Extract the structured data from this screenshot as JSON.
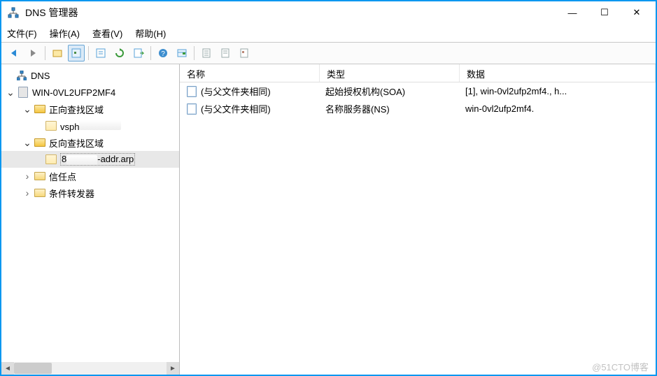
{
  "window": {
    "title": "DNS 管理器"
  },
  "menu": {
    "file": "文件(F)",
    "operate": "操作(A)",
    "view": "查看(V)",
    "help": "帮助(H)"
  },
  "tree": {
    "root": "DNS",
    "server": "WIN-0VL2UFP2MF4",
    "forward_zone": "正向查找区域",
    "forward_item_prefix": "vsph",
    "reverse_zone": "反向查找区域",
    "reverse_item_prefix": "8",
    "reverse_item_suffix": "-addr.arp",
    "trust": "信任点",
    "conditional": "条件转发器"
  },
  "columns": {
    "name": "名称",
    "type": "类型",
    "data": "数据"
  },
  "rows": [
    {
      "name": "(与父文件夹相同)",
      "type": "起始授权机构(SOA)",
      "data": "[1], win-0vl2ufp2mf4., h..."
    },
    {
      "name": "(与父文件夹相同)",
      "type": "名称服务器(NS)",
      "data": "win-0vl2ufp2mf4."
    }
  ],
  "watermark": "@51CTO博客"
}
